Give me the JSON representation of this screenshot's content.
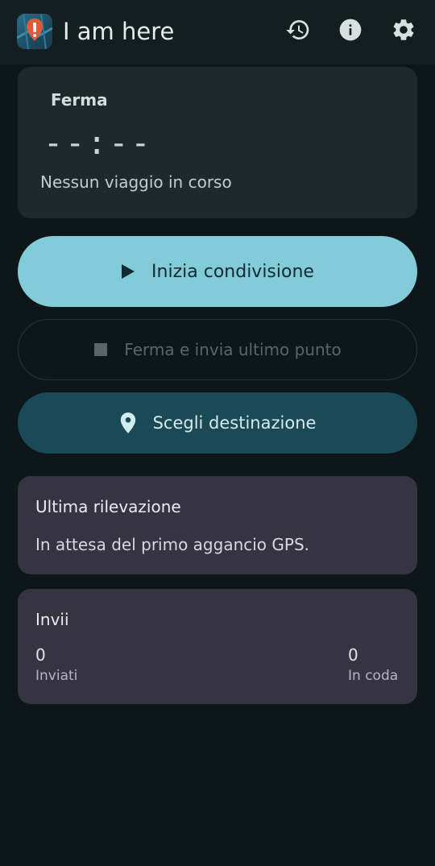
{
  "app": {
    "title": "I am here",
    "icons": {
      "logo": "app-logo-icon",
      "history": "history-icon",
      "info": "info-icon",
      "settings": "gear-icon"
    }
  },
  "status": {
    "label": "Ferma",
    "time": "--:--",
    "message": "Nessun viaggio in corso"
  },
  "actions": {
    "start_label": "Inizia condivisione",
    "stop_label": "Ferma e invia ultimo punto",
    "destination_label": "Scegli destinazione"
  },
  "last_fix": {
    "title": "Ultima rilevazione",
    "message": "In attesa del primo aggancio GPS."
  },
  "sends": {
    "title": "Invii",
    "sent_value": "0",
    "sent_label": "Inviati",
    "queued_value": "0",
    "queued_label": "In coda"
  },
  "colors": {
    "background": "#0d1719",
    "primary_button": "#82cbd8",
    "tonal_button": "#1a4a56",
    "card": "#363441"
  }
}
